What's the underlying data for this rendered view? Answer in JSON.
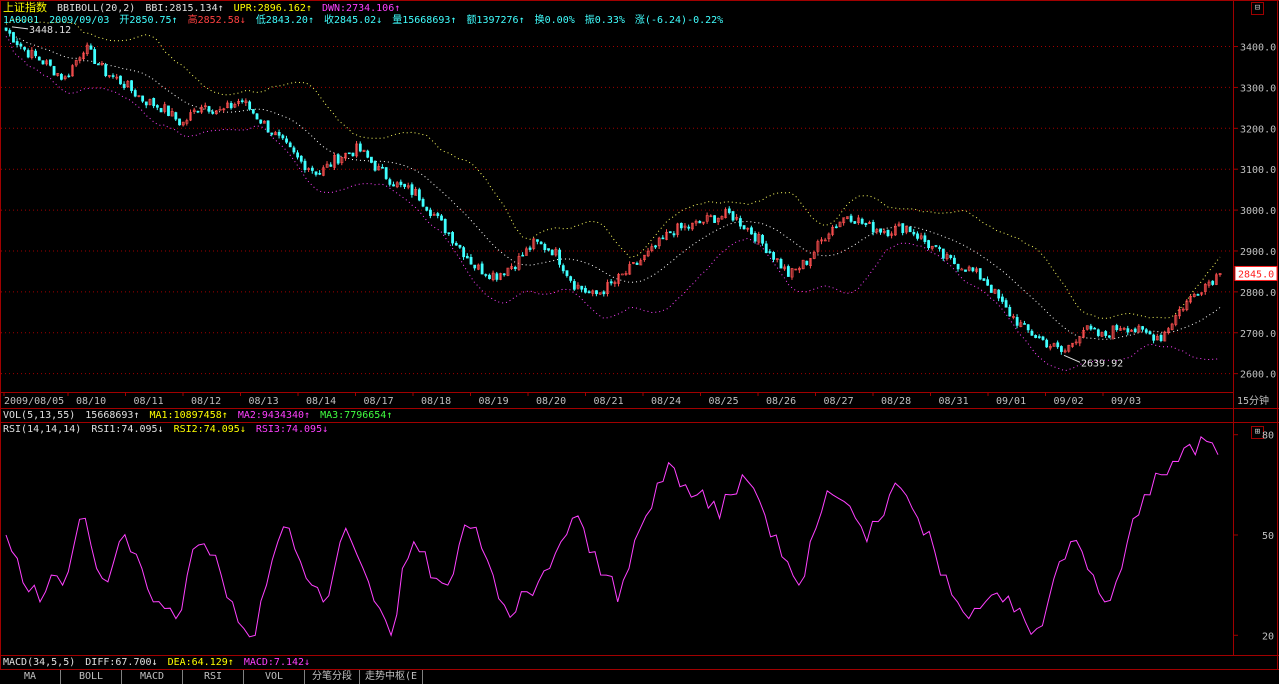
{
  "header": {
    "index_name": "上证指数",
    "indicator": "BBIBOLL(20,2)",
    "bbi": "BBI:2815.134↑",
    "upr": "UPR:2896.162↑",
    "dwn": "DWN:2734.106↑",
    "code": "1A0001",
    "date": "2009/09/03",
    "open": "开2850.75↑",
    "high": "高2852.58↓",
    "low": "低2843.20↑",
    "close": "收2845.02↓",
    "volume": "量15668693↑",
    "amount": "额1397276↑",
    "turnover": "换0.00%",
    "amplitude": "振0.33%",
    "change": "涨(-6.24)-0.22%"
  },
  "vol_panel": {
    "label": "VOL(5,13,55)",
    "value": "15668693↑",
    "ma1": "MA1:10897458↑",
    "ma2": "MA2:9434340↑",
    "ma3": "MA3:7796654↑"
  },
  "rsi_panel": {
    "label": "RSI(14,14,14)",
    "rsi1": "RSI1:74.095↓",
    "rsi2": "RSI2:74.095↓",
    "rsi3": "RSI3:74.095↓"
  },
  "macd_panel": {
    "label": "MACD(34,5,5)",
    "diff": "DIFF:67.700↓",
    "dea": "DEA:64.129↑",
    "macd": "MACD:7.142↓"
  },
  "tabs": [
    "MA",
    "BOLL",
    "MACD",
    "RSI",
    "VOL",
    "分笔分段",
    "走势中枢(E"
  ],
  "colors": {
    "frame": "#a00000",
    "rise": "#ff5050",
    "fall": "#40ffff",
    "upr": "#ffff60",
    "dwn": "#ff40ff",
    "bbi": "#ffffff",
    "rsi": "#ff40ff"
  },
  "chart_data": [
    {
      "type": "candlestick",
      "title": "上证指数 15分钟",
      "period_label": "15分钟",
      "ylim": [
        2560,
        3460
      ],
      "y_ticks": [
        3400,
        3300,
        3200,
        3100,
        3000,
        2900,
        2800,
        2700,
        2600
      ],
      "y_tick_labels": [
        "3400.0",
        "3300.0",
        "3200.0",
        "3100.0",
        "3000.0",
        "2900.0",
        "2800.0",
        "2700.0",
        "2600.0"
      ],
      "x_labels": [
        "2009/08/05",
        "08/10",
        "08/11",
        "08/12",
        "08/13",
        "08/14",
        "08/17",
        "08/18",
        "08/19",
        "08/20",
        "08/21",
        "08/24",
        "08/25",
        "08/26",
        "08/27",
        "08/28",
        "08/31",
        "09/01",
        "09/02",
        "09/03"
      ],
      "last_price_label": "2845.0",
      "annotations": [
        {
          "text": "3448.12",
          "value": 3448.12,
          "kind": "high"
        },
        {
          "text": "2639.92",
          "value": 2639.92,
          "kind": "low"
        }
      ],
      "close_path": [
        {
          "x": "2009/08/05",
          "y": 3440
        },
        {
          "x": "2009/08/05",
          "y": 3390
        },
        {
          "x": "2009/08/05",
          "y": 3360
        },
        {
          "x": "08/06",
          "y": 3320
        },
        {
          "x": "08/06",
          "y": 3400
        },
        {
          "x": "08/07",
          "y": 3340
        },
        {
          "x": "08/10",
          "y": 3310
        },
        {
          "x": "08/10",
          "y": 3270
        },
        {
          "x": "08/10",
          "y": 3250
        },
        {
          "x": "08/11",
          "y": 3210
        },
        {
          "x": "08/11",
          "y": 3260
        },
        {
          "x": "08/11",
          "y": 3240
        },
        {
          "x": "08/12",
          "y": 3270
        },
        {
          "x": "08/12",
          "y": 3220
        },
        {
          "x": "08/12",
          "y": 3170
        },
        {
          "x": "08/13",
          "y": 3120
        },
        {
          "x": "08/13",
          "y": 3090
        },
        {
          "x": "08/13",
          "y": 3130
        },
        {
          "x": "08/14",
          "y": 3150
        },
        {
          "x": "08/14",
          "y": 3100
        },
        {
          "x": "08/14",
          "y": 3060
        },
        {
          "x": "08/17",
          "y": 3040
        },
        {
          "x": "08/17",
          "y": 2980
        },
        {
          "x": "08/17",
          "y": 2920
        },
        {
          "x": "08/18",
          "y": 2860
        },
        {
          "x": "08/18",
          "y": 2840
        },
        {
          "x": "08/18",
          "y": 2870
        },
        {
          "x": "08/19",
          "y": 2920
        },
        {
          "x": "08/19",
          "y": 2900
        },
        {
          "x": "08/19",
          "y": 2820
        },
        {
          "x": "08/20",
          "y": 2790
        },
        {
          "x": "08/20",
          "y": 2820
        },
        {
          "x": "08/20",
          "y": 2860
        },
        {
          "x": "08/21",
          "y": 2900
        },
        {
          "x": "08/21",
          "y": 2950
        },
        {
          "x": "08/21",
          "y": 2960
        },
        {
          "x": "08/24",
          "y": 2980
        },
        {
          "x": "08/24",
          "y": 2990
        },
        {
          "x": "08/24",
          "y": 2950
        },
        {
          "x": "08/25",
          "y": 2900
        },
        {
          "x": "08/25",
          "y": 2840
        },
        {
          "x": "08/25",
          "y": 2880
        },
        {
          "x": "08/26",
          "y": 2950
        },
        {
          "x": "08/26",
          "y": 2990
        },
        {
          "x": "08/26",
          "y": 2960
        },
        {
          "x": "08/27",
          "y": 2950
        },
        {
          "x": "08/27",
          "y": 2960
        },
        {
          "x": "08/27",
          "y": 2920
        },
        {
          "x": "08/28",
          "y": 2880
        },
        {
          "x": "08/28",
          "y": 2860
        },
        {
          "x": "08/28",
          "y": 2830
        },
        {
          "x": "08/31",
          "y": 2760
        },
        {
          "x": "08/31",
          "y": 2710
        },
        {
          "x": "08/31",
          "y": 2680
        },
        {
          "x": "09/01",
          "y": 2650
        },
        {
          "x": "09/01",
          "y": 2710
        },
        {
          "x": "09/01",
          "y": 2690
        },
        {
          "x": "09/02",
          "y": 2720
        },
        {
          "x": "09/02",
          "y": 2700
        },
        {
          "x": "09/02",
          "y": 2690
        },
        {
          "x": "09/03",
          "y": 2760
        },
        {
          "x": "09/03",
          "y": 2810
        },
        {
          "x": "09/03",
          "y": 2845
        }
      ],
      "series": [
        {
          "name": "BBI",
          "value": 2815.134
        },
        {
          "name": "UPR",
          "value": 2896.162
        },
        {
          "name": "DWN",
          "value": 2734.106
        }
      ]
    },
    {
      "type": "line",
      "title": "RSI(14,14,14)",
      "ylim": [
        15,
        82
      ],
      "y_ticks": [
        80,
        50,
        20
      ],
      "series": [
        {
          "name": "RSI1",
          "values": [
            50,
            43,
            33,
            30,
            38,
            35,
            47,
            55,
            40,
            36,
            48,
            45,
            40,
            30,
            28,
            25,
            38,
            47,
            44,
            38,
            30,
            22,
            20,
            35,
            48,
            52,
            42,
            35,
            30,
            40,
            52,
            44,
            36,
            28,
            20,
            40,
            48,
            45,
            37,
            35,
            47,
            52,
            46,
            38,
            29,
            27,
            33,
            36,
            40,
            48,
            55,
            52,
            45,
            38,
            30,
            40,
            52,
            58,
            66,
            70,
            65,
            62,
            58,
            55,
            62,
            68,
            64,
            56,
            50,
            42,
            35,
            48,
            57,
            62,
            60,
            55,
            48,
            54,
            62,
            64,
            58,
            50,
            45,
            38,
            30,
            25,
            28,
            32,
            30,
            27,
            24,
            22,
            30,
            42,
            48,
            45,
            38,
            30,
            36,
            48,
            56,
            62,
            68,
            72,
            76,
            74,
            78,
            74
          ]
        }
      ]
    }
  ]
}
